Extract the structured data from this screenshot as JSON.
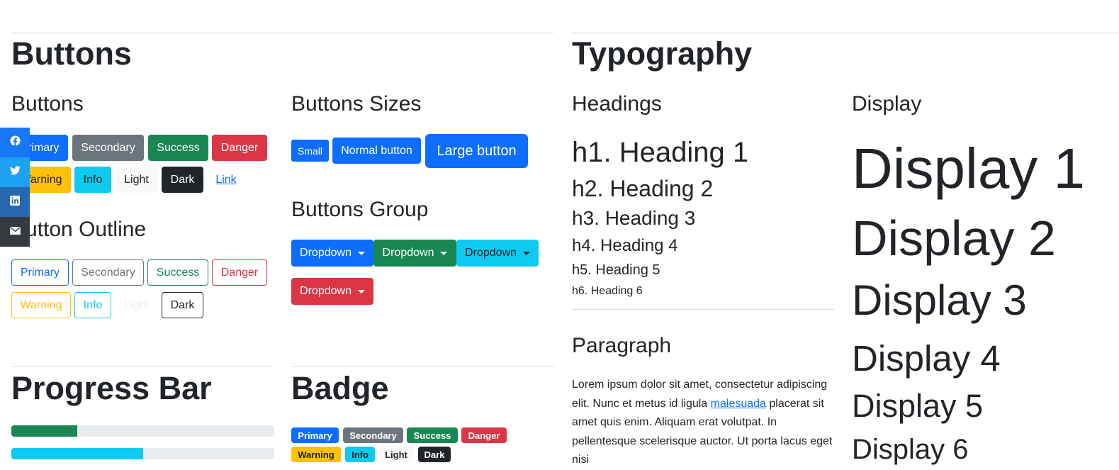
{
  "colors": {
    "primary": "#0d6efd",
    "secondary": "#6c757d",
    "success": "#198754",
    "danger": "#dc3545",
    "warning": "#ffc107",
    "info": "#0dcaf0",
    "light": "#f8f9fa",
    "dark": "#212529"
  },
  "buttons_section": {
    "title": "Buttons",
    "buttons": {
      "subtitle": "Buttons",
      "row1": [
        "Primary",
        "Secondary",
        "Success",
        "Danger"
      ],
      "row2": [
        "Warning",
        "Info",
        "Light",
        "Dark",
        "Link"
      ]
    },
    "outline": {
      "subtitle": "Button Outline",
      "row1": [
        "Primary",
        "Secondary",
        "Success",
        "Danger"
      ],
      "row2": [
        "Warning",
        "Info",
        "Light",
        "Dark"
      ]
    },
    "sizes": {
      "subtitle": "Buttons Sizes",
      "small": "Small",
      "normal": "Normal button",
      "large": "Large button"
    },
    "group": {
      "subtitle": "Buttons Group",
      "dropdowns": [
        "Dropdown",
        "Dropdown",
        "Dropdown",
        "Dropdown"
      ]
    }
  },
  "progress": {
    "title": "Progress Bar",
    "bars": [
      {
        "value": 0.25,
        "color": "#198754"
      },
      {
        "value": 0.5,
        "color": "#0dcaf0"
      }
    ]
  },
  "badge": {
    "title": "Badge",
    "row1": [
      "Primary",
      "Secondary",
      "Success",
      "Danger"
    ],
    "row2": [
      "Warning",
      "Info",
      "Light",
      "Dark"
    ]
  },
  "typography": {
    "title": "Typography",
    "headings": {
      "subtitle": "Headings",
      "items": [
        "h1. Heading 1",
        "h2. Heading 2",
        "h3. Heading 3",
        "h4. Heading 4",
        "h5. Heading 5",
        "h6. Heading 6"
      ]
    },
    "paragraph": {
      "subtitle": "Paragraph",
      "text_before": "Lorem ipsum dolor sit amet, consectetur adipiscing elit. Nunc et metus id ligula",
      "link": "malesuada",
      "text_after": "placerat sit amet quis enim. Aliquam erat volutpat. In pellentesque scelerisque auctor. Ut porta lacus eget nisi"
    },
    "display": {
      "subtitle": "Display",
      "items": [
        "Display 1",
        "Display 2",
        "Display 3",
        "Display 4",
        "Display 5",
        "Display 6"
      ]
    }
  },
  "share_bar": {
    "icons": [
      "facebook-icon",
      "twitter-icon",
      "linkedin-icon",
      "email-icon"
    ]
  }
}
